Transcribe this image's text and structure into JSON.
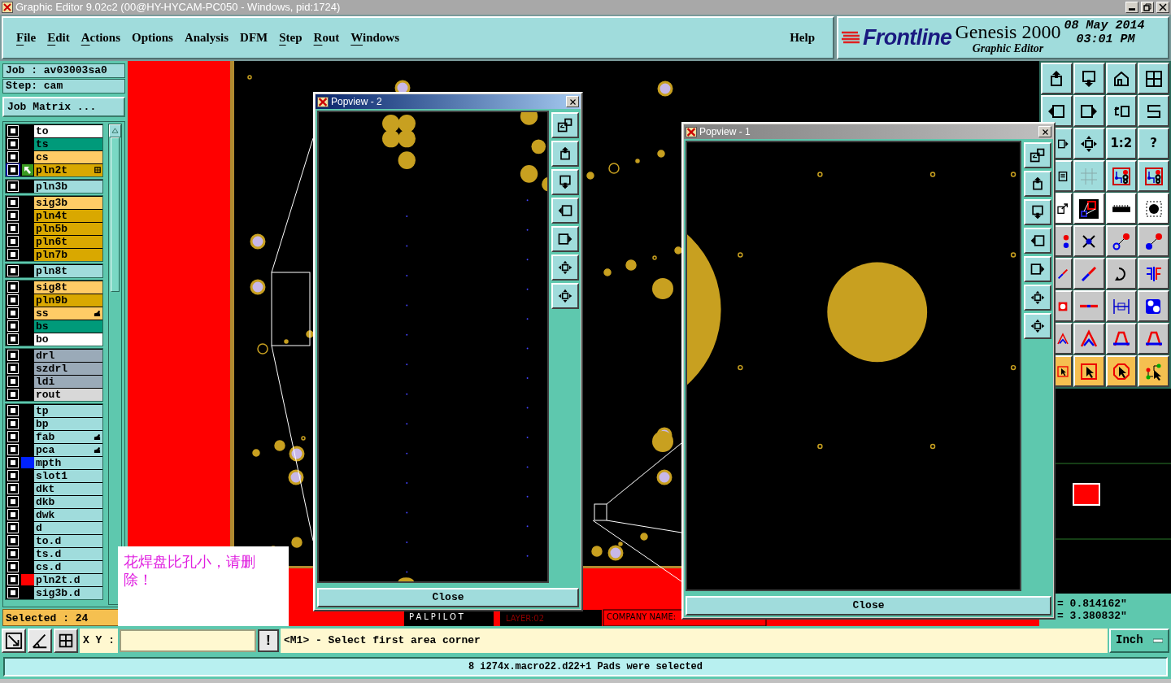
{
  "title_bar": {
    "title": "Graphic Editor 9.02c2 (00@HY-HYCAM-PC050 - Windows, pid:1724)"
  },
  "menu": [
    {
      "label": "File",
      "underline": true
    },
    {
      "label": "Edit",
      "underline": true
    },
    {
      "label": "Actions",
      "underline": true
    },
    {
      "label": "Options",
      "underline": false
    },
    {
      "label": "Analysis",
      "underline": false
    },
    {
      "label": "DFM",
      "underline": false
    },
    {
      "label": "Step",
      "underline": true
    },
    {
      "label": "Rout",
      "underline": true
    },
    {
      "label": "Windows",
      "underline": true
    }
  ],
  "help_menu": {
    "label": "Help"
  },
  "logo": {
    "brand": "Frontline",
    "product": "Genesis 2000",
    "subtitle": "Graphic Editor",
    "date": "08 May 2014",
    "time": "03:01 PM"
  },
  "job": {
    "job": "Job : av03003sa0",
    "step": "Step: cam",
    "matrix_button": "Job Matrix ..."
  },
  "layer_groups": [
    {
      "layers": [
        {
          "name": "to",
          "color": "#ffffff",
          "work_layer": false
        },
        {
          "name": "ts",
          "color": "#009a7a",
          "work_layer": false
        },
        {
          "name": "cs",
          "color": "#ffcc66",
          "work_layer": false
        },
        {
          "name": "pln2t",
          "color": "#d9a800",
          "work_layer": true,
          "kind": "grid"
        }
      ]
    },
    {
      "layers": [
        {
          "name": "pln3b",
          "color": "#a0dcdc",
          "work_layer": false
        }
      ]
    },
    {
      "layers": [
        {
          "name": "sig3b",
          "color": "#ffcc66",
          "work_layer": false
        },
        {
          "name": "pln4t",
          "color": "#d9a800",
          "work_layer": false
        },
        {
          "name": "pln5b",
          "color": "#d9a800",
          "work_layer": false
        },
        {
          "name": "pln6t",
          "color": "#d9a800",
          "work_layer": false
        },
        {
          "name": "pln7b",
          "color": "#d9a800",
          "work_layer": false
        }
      ]
    },
    {
      "layers": [
        {
          "name": "pln8t",
          "color": "#a0dcdc",
          "work_layer": false
        }
      ]
    },
    {
      "layers": [
        {
          "name": "sig8t",
          "color": "#ffcc66",
          "work_layer": false
        },
        {
          "name": "pln9b",
          "color": "#d9a800",
          "work_layer": false
        },
        {
          "name": "ss",
          "color": "#ffcc66",
          "work_layer": false,
          "kind": "hand"
        },
        {
          "name": "bs",
          "color": "#009a7a",
          "work_layer": false
        },
        {
          "name": "bo",
          "color": "#ffffff",
          "work_layer": false
        }
      ]
    },
    {
      "layers": [
        {
          "name": "drl",
          "color": "#9aaab8",
          "work_layer": false
        },
        {
          "name": "szdrl",
          "color": "#9aaab8",
          "work_layer": false
        },
        {
          "name": "ldi",
          "color": "#9aaab8",
          "work_layer": false
        },
        {
          "name": "rout",
          "color": "#d8d8d8",
          "work_layer": false
        }
      ]
    },
    {
      "layers": [
        {
          "name": "tp",
          "color": "#a0dcdc",
          "work_layer": false
        },
        {
          "name": "bp",
          "color": "#a0dcdc",
          "work_layer": false
        },
        {
          "name": "fab",
          "color": "#a0dcdc",
          "work_layer": false,
          "kind": "hand"
        },
        {
          "name": "pca",
          "color": "#a0dcdc",
          "work_layer": false,
          "kind": "hand"
        },
        {
          "name": "mpth",
          "color": "#a0dcdc",
          "work_layer": false,
          "swatch": {
            "color": "#0022ff"
          }
        },
        {
          "name": "slot1",
          "color": "#a0dcdc",
          "work_layer": false
        },
        {
          "name": "dkt",
          "color": "#a0dcdc",
          "work_layer": false
        },
        {
          "name": "dkb",
          "color": "#a0dcdc",
          "work_layer": false
        },
        {
          "name": "dwk",
          "color": "#a0dcdc",
          "work_layer": false
        },
        {
          "name": "d",
          "color": "#a0dcdc",
          "work_layer": false
        },
        {
          "name": "to.d",
          "color": "#a0dcdc",
          "work_layer": false
        },
        {
          "name": "ts.d",
          "color": "#a0dcdc",
          "work_layer": false
        },
        {
          "name": "cs.d",
          "color": "#a0dcdc",
          "work_layer": false
        },
        {
          "name": "pln2t.d",
          "color": "#a0dcdc",
          "work_layer": false,
          "swatch": {
            "color": "#ff0000"
          }
        },
        {
          "name": "sig3b.d",
          "color": "#a0dcdc",
          "work_layer": false
        }
      ]
    }
  ],
  "selected_count": "Selected : 24",
  "popviews": [
    {
      "title": "Popview - 2",
      "active": true,
      "close_label": "Close"
    },
    {
      "title": "Popview - 1",
      "active": false,
      "close_label": "Close"
    }
  ],
  "canvas_labels": [
    "PALPILOT",
    "LAYER:02",
    "COMPANY NAME:"
  ],
  "toolbar": [
    {
      "kind": "box-up"
    },
    {
      "kind": "box-down"
    },
    {
      "kind": "house"
    },
    {
      "kind": "grid-window"
    },
    {
      "kind": "box-left"
    },
    {
      "kind": "box-right"
    },
    {
      "kind": "undo-box"
    },
    {
      "kind": "s-curve"
    },
    {
      "kind": "box-side"
    },
    {
      "kind": "four-arrows"
    },
    {
      "kind": "text",
      "label": "1:2"
    },
    {
      "kind": "text",
      "label": "?"
    },
    {
      "kind": "notepad"
    },
    {
      "kind": "grid"
    },
    {
      "kind": "circuit"
    },
    {
      "kind": "circuit"
    },
    {
      "kind": "arrow-out"
    },
    {
      "kind": "zoom-box"
    },
    {
      "kind": "ruler"
    },
    {
      "kind": "pad-dot"
    },
    {
      "kind": "dots"
    },
    {
      "kind": "cross-dot"
    },
    {
      "kind": "connect"
    },
    {
      "kind": "connect-filled"
    },
    {
      "kind": "slash"
    },
    {
      "kind": "slash"
    },
    {
      "kind": "curve-arrow"
    },
    {
      "kind": "mirror"
    },
    {
      "kind": "pad-square"
    },
    {
      "kind": "segment"
    },
    {
      "kind": "measure"
    },
    {
      "kind": "blobs"
    },
    {
      "kind": "triangle"
    },
    {
      "kind": "triangle"
    },
    {
      "kind": "arch"
    },
    {
      "kind": "arch"
    },
    {
      "kind": "pointer"
    },
    {
      "kind": "pointer"
    },
    {
      "kind": "pointer-octagon"
    },
    {
      "kind": "pointer-route"
    }
  ],
  "coordinates": [
    "= 0.814162\"",
    "= 3.380832\""
  ],
  "command_bar": {
    "xy_label": "X Y :",
    "exclaim_button": "!",
    "prompt": "<M1> - Select first area corner",
    "units": "Inch"
  },
  "status": "8 i274x.macro22.d22+1 Pads were selected",
  "note": "花焊盘比孔小，请删除！"
}
